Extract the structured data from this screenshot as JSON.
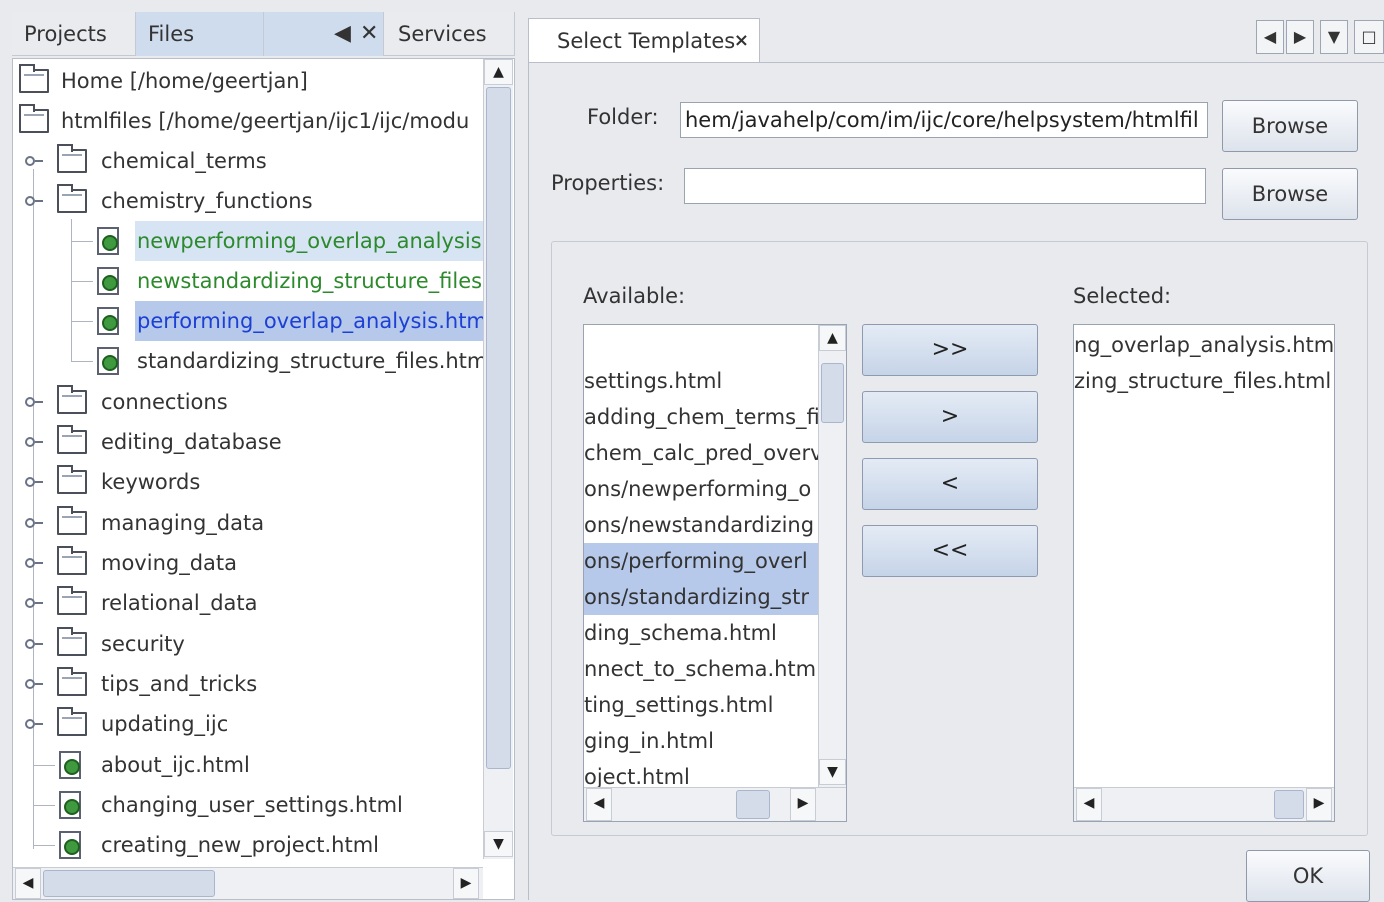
{
  "left_tabs": {
    "projects": "Projects",
    "files": "Files",
    "services": "Services"
  },
  "tree": {
    "home": "Home [/home/geertjan]",
    "htmlfiles": "htmlfiles [/home/geertjan/ijc1/ijc/modu",
    "chemical_terms": "chemical_terms",
    "chemistry_functions": "chemistry_functions",
    "chem_files": [
      "newperforming_overlap_analysis.",
      "newstandardizing_structure_files",
      "performing_overlap_analysis.htm",
      "standardizing_structure_files.htm"
    ],
    "folders": [
      "connections",
      "editing_database",
      "keywords",
      "managing_data",
      "moving_data",
      "relational_data",
      "security",
      "tips_and_tricks",
      "updating_ijc"
    ],
    "files": [
      "about_ijc.html",
      "changing_user_settings.html",
      "creating_new_project.html"
    ]
  },
  "dialog": {
    "tab_title": "Select Templates",
    "folder_label": "Folder:",
    "folder_value": "hem/javahelp/com/im/ijc/core/helpsystem/htmlfil",
    "properties_label": "Properties:",
    "properties_value": "",
    "browse_label": "Browse",
    "available_label": "Available:",
    "selected_label": "Selected:",
    "available_items": [
      "settings.html",
      "adding_chem_terms_fi",
      "chem_calc_pred_overv",
      "ons/newperforming_o",
      "ons/newstandardizing",
      "ons/performing_overl",
      "ons/standardizing_str",
      "ding_schema.html",
      "nnect_to_schema.html",
      "ting_settings.html",
      "ging_in.html",
      "oject.html"
    ],
    "selected_items": [
      "ng_overlap_analysis.html",
      "zing_structure_files.html"
    ],
    "move_all_right": ">>",
    "move_right": ">",
    "move_left": "<",
    "move_all_left": "<<",
    "ok_label": "OK"
  },
  "colors": {
    "selection": "#b7c9ea",
    "modified_file_text": "#2c8a2c",
    "selected_file_text": "#1c3fd4"
  }
}
